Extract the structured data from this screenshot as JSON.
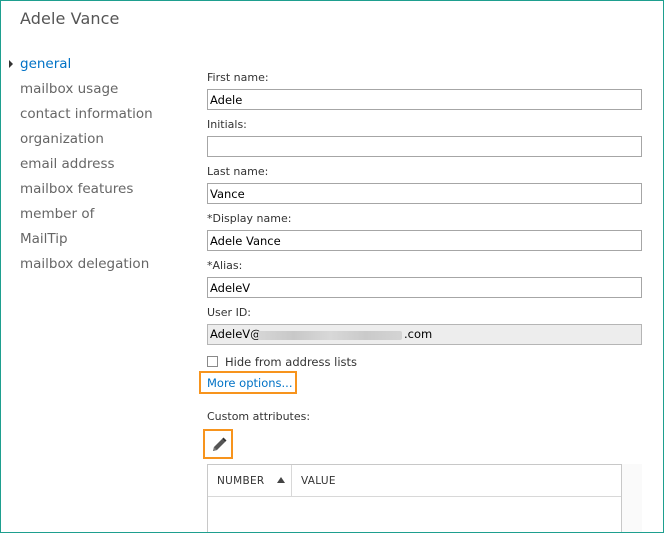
{
  "window": {
    "title": "Adele Vance"
  },
  "nav": {
    "items": [
      {
        "label": "general",
        "active": true
      },
      {
        "label": "mailbox usage"
      },
      {
        "label": "contact information"
      },
      {
        "label": "organization"
      },
      {
        "label": "email address"
      },
      {
        "label": "mailbox features"
      },
      {
        "label": "member of"
      },
      {
        "label": "MailTip"
      },
      {
        "label": "mailbox delegation"
      }
    ]
  },
  "form": {
    "first_name": {
      "label": "First name:",
      "value": "Adele"
    },
    "initials": {
      "label": "Initials:",
      "value": ""
    },
    "last_name": {
      "label": "Last name:",
      "value": "Vance"
    },
    "display_name": {
      "label": "*Display name:",
      "value": "Adele Vance"
    },
    "alias": {
      "label": "*Alias:",
      "value": "AdeleV"
    },
    "user_id": {
      "label": "User ID:",
      "value_prefix": "AdeleV@",
      "value_suffix": ".com"
    },
    "hide_from_address_lists": {
      "label": "Hide from address lists",
      "checked": false
    },
    "more_options": {
      "label": "More options..."
    },
    "custom_attributes": {
      "label": "Custom attributes:",
      "columns": [
        "NUMBER",
        "VALUE"
      ],
      "sort_column": "NUMBER",
      "sort_direction": "ascending"
    }
  },
  "colors": {
    "accent": "#0072c6",
    "highlight": "#f7941d",
    "frame": "#1e9f8f"
  },
  "icons": {
    "nav_active": "caret-right-icon",
    "edit": "pencil-icon",
    "sort": "sort-ascending-icon"
  }
}
